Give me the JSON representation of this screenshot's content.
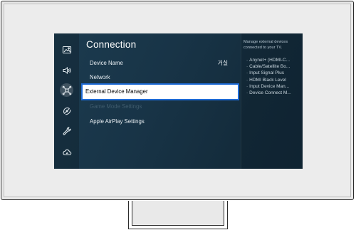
{
  "sidebar": {
    "icons": [
      {
        "name": "picture-icon"
      },
      {
        "name": "sound-icon"
      },
      {
        "name": "connection-icon",
        "active": true
      },
      {
        "name": "broadcasting-icon"
      },
      {
        "name": "support-icon"
      },
      {
        "name": "cloud-icon"
      }
    ]
  },
  "menu": {
    "title": "Connection",
    "items": [
      {
        "label": "Device Name",
        "value": "거실",
        "state": "normal"
      },
      {
        "label": "Network",
        "value": "",
        "state": "normal"
      },
      {
        "label": "External Device Manager",
        "value": "",
        "state": "selected"
      },
      {
        "label": "Game Mode Settings",
        "value": "",
        "state": "disabled"
      },
      {
        "label": "Apple AirPlay Settings",
        "value": "",
        "state": "normal"
      }
    ]
  },
  "description": {
    "text": "Manage external devices connected to your TV.",
    "items": [
      "Anynet+ (HDMI-C...",
      "Cable/Satellite Bo...",
      "Input Signal Plus",
      "HDMI Black Level",
      "Input Device Man...",
      "Device Connect M..."
    ]
  },
  "colors": {
    "accent": "#1e6bd6",
    "screen_bg": "#183447",
    "selected_bg": "#ffffff"
  }
}
